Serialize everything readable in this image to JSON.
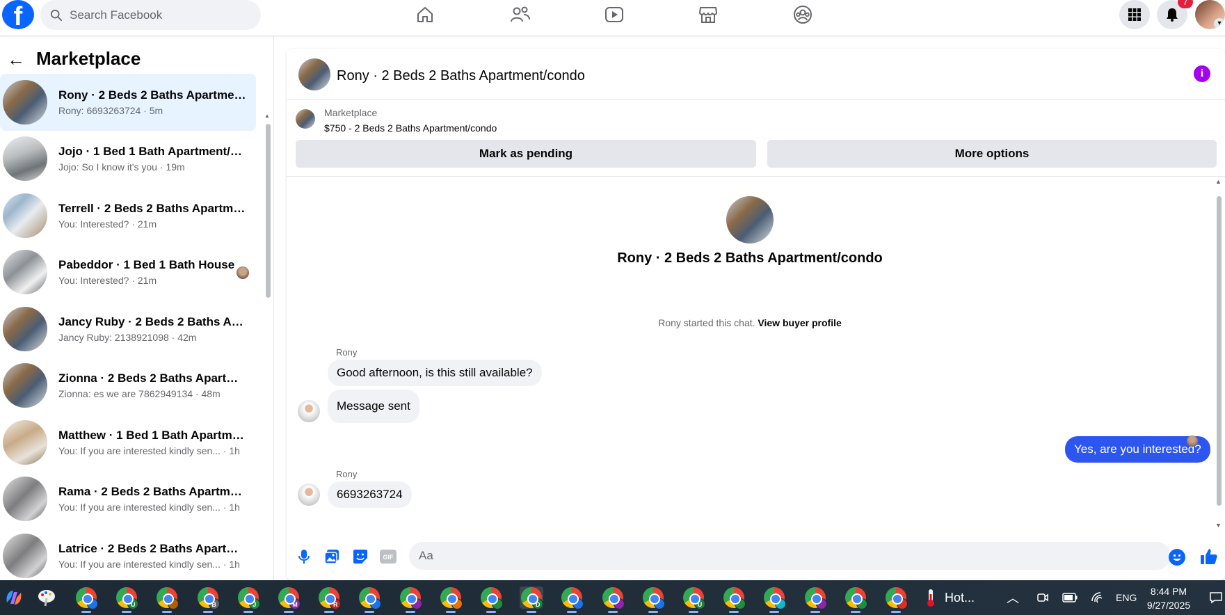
{
  "topbar": {
    "logo": "f",
    "search_placeholder": "Search Facebook",
    "nav_icons": [
      "home-icon",
      "friends-icon",
      "watch-icon",
      "marketplace-icon",
      "groups-icon"
    ],
    "notification_count": "7"
  },
  "sidebar": {
    "title": "Marketplace",
    "conversations": [
      {
        "title": "Rony · 2 Beds 2 Baths Apartmen...",
        "subtitle": "Rony: 6693263724 · 5m"
      },
      {
        "title": "Jojo · 1 Bed 1 Bath Apartment/c...",
        "subtitle": "Jojo: So I know it's you · 19m"
      },
      {
        "title": "Terrell · 2 Beds 2 Baths Apartme...",
        "subtitle": "You: Interested? · 21m"
      },
      {
        "title": "Pabeddor · 1 Bed 1 Bath House",
        "subtitle": "You: Interested? · 21m"
      },
      {
        "title": "Jancy Ruby · 2 Beds 2 Baths Apa...",
        "subtitle": "Jancy Ruby: 2138921098 · 42m"
      },
      {
        "title": "Zionna · 2 Beds 2 Baths Apartm...",
        "subtitle": "Zionna: es we are 7862949134 · 48m"
      },
      {
        "title": "Matthew · 1 Bed 1 Bath Apartme...",
        "subtitle": "You: If you are interested kindly sen... · 1h"
      },
      {
        "title": "Rama · 2 Beds 2 Baths Apartme...",
        "subtitle": "You: If you are interested kindly sen... · 1h"
      },
      {
        "title": "Latrice · 2 Beds 2 Baths Apartme...",
        "subtitle": "You: If you are interested kindly sen... · 1h"
      }
    ]
  },
  "chat": {
    "header_title": "Rony · 2 Beds 2 Baths Apartment/condo",
    "listing_source": "Marketplace",
    "listing_price_title": "$750 - 2 Beds 2 Baths Apartment/condo",
    "mark_pending_label": "Mark as pending",
    "more_options_label": "More options",
    "intro_title": "Rony · 2 Beds 2 Baths Apartment/condo",
    "started_text": "Rony started this chat.",
    "view_profile_label": "View buyer profile",
    "messages": [
      {
        "sender": "Rony",
        "text": "Good afternoon, is this still available?"
      },
      {
        "sender": "",
        "text": "Message sent"
      },
      {
        "sender": "me",
        "text": "Yes, are you interested?"
      },
      {
        "sender": "Rony",
        "text": "6693263724"
      }
    ],
    "composer_placeholder": "Aa"
  },
  "taskbar": {
    "weather_text": "Hot...",
    "language": "ENG",
    "time": "8:44 PM",
    "date": "9/27/2025",
    "profile_letters": [
      "",
      "U",
      "",
      "B",
      "J",
      "M",
      "R",
      "",
      "",
      "",
      "",
      "D",
      "",
      "",
      "",
      "U",
      "",
      "",
      "",
      "",
      ""
    ]
  },
  "colors": {
    "brand": "#0866ff",
    "outgoing_bubble": "#2d56f0",
    "active_conversation": "#e7f3ff",
    "info_icon": "#a400f0"
  }
}
